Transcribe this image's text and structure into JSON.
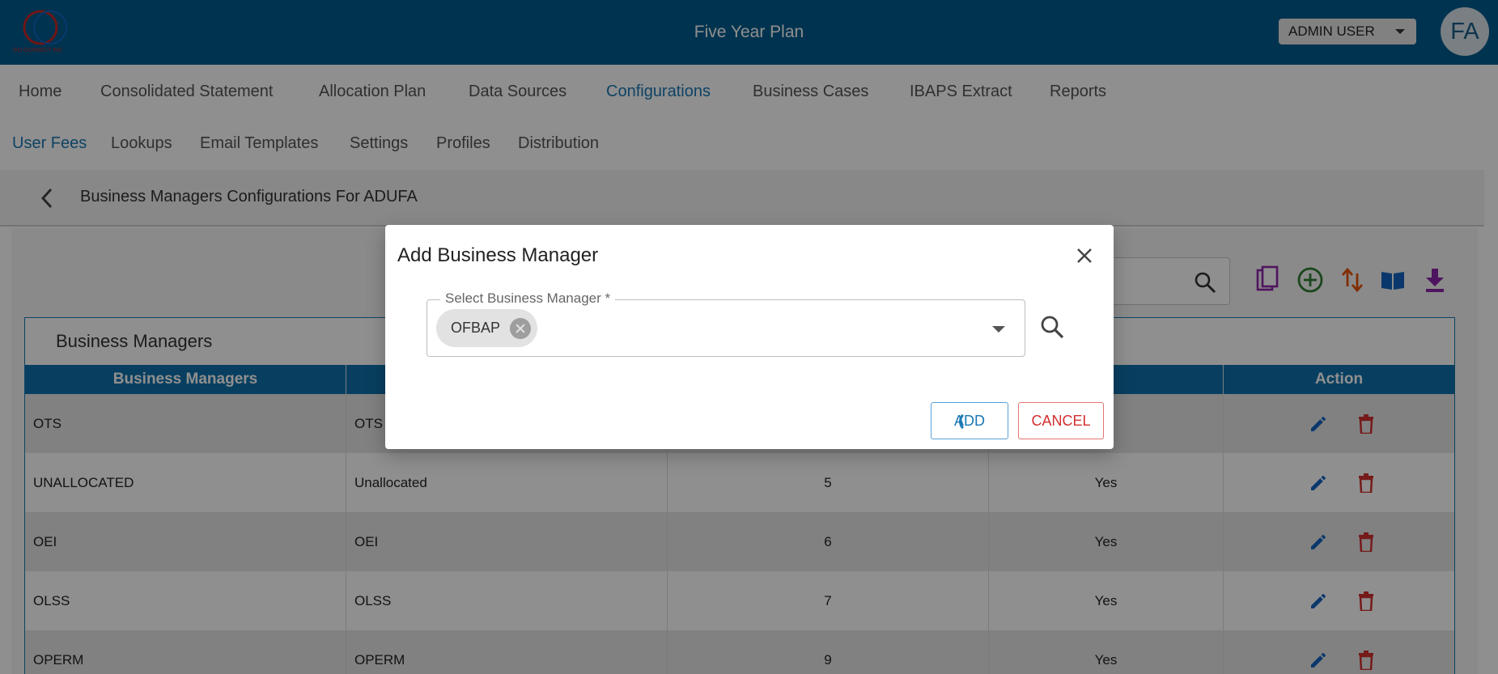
{
  "header": {
    "title": "Five Year Plan",
    "user_label": "ADMIN USER",
    "avatar_initials": "FA"
  },
  "main_nav": [
    "Home",
    "Consolidated Statement",
    "Allocation Plan",
    "Data Sources",
    "Configurations",
    "Business Cases",
    "IBAPS Extract",
    "Reports"
  ],
  "main_nav_active": "Configurations",
  "sub_nav": [
    "User Fees",
    "Lookups",
    "Email Templates",
    "Settings",
    "Profiles",
    "Distribution"
  ],
  "sub_nav_active": "User Fees",
  "breadcrumb": {
    "title": "Business Managers Configurations For ADUFA"
  },
  "panel": {
    "title": "Business Managers",
    "columns": [
      "Business Managers",
      "",
      "",
      "d",
      "Action"
    ],
    "rows": [
      [
        "OTS",
        "OTS",
        "",
        "s"
      ],
      [
        "UNALLOCATED",
        "Unallocated",
        "5",
        "Yes"
      ],
      [
        "OEI",
        "OEI",
        "6",
        "Yes"
      ],
      [
        "OLSS",
        "OLSS",
        "7",
        "Yes"
      ],
      [
        "OPERM",
        "OPERM",
        "9",
        "Yes"
      ]
    ]
  },
  "toolbar_icons": [
    "copy-icon",
    "add-circle-icon",
    "sort-icon",
    "book-icon",
    "download-icon"
  ],
  "dialog": {
    "title": "Add Business Manager",
    "field_label": "Select Business Manager *",
    "selected_chip": "OFBAP",
    "add_label": "ADD",
    "cancel_label": "CANCEL"
  },
  "colors": {
    "header_bg": "#005b8e",
    "accent": "#1a78b4",
    "table_header": "#0f70ab",
    "danger": "#d32f2f"
  }
}
